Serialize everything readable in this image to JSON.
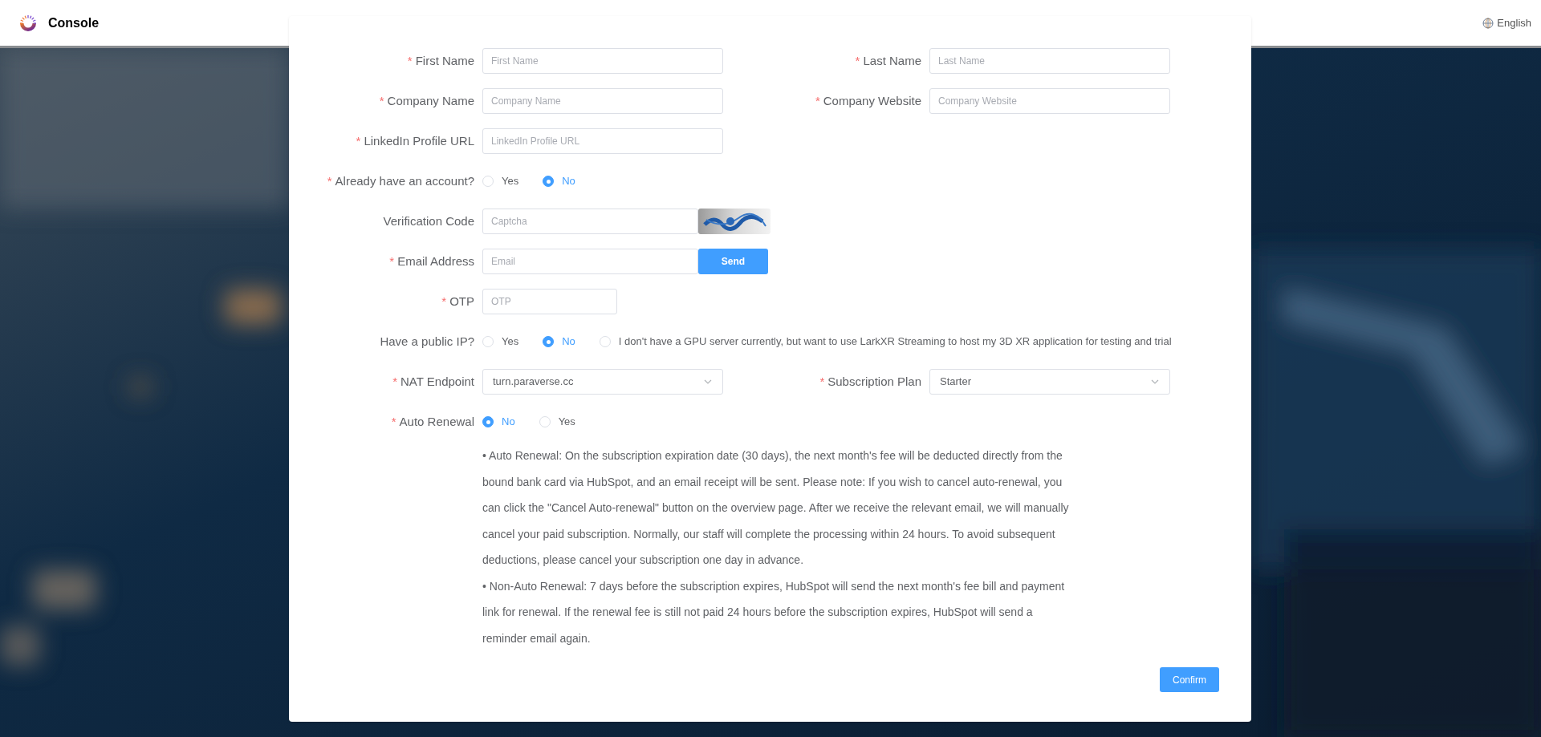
{
  "header": {
    "brand": "Console",
    "language": "English"
  },
  "form": {
    "rows": [
      {
        "fields": [
          {
            "kind": "text",
            "label": "First Name",
            "required_mark": "*",
            "placeholder": "First Name"
          },
          {
            "kind": "text",
            "label": "Last Name",
            "required_mark": "*",
            "placeholder": "Last Name"
          }
        ]
      },
      {
        "fields": [
          {
            "kind": "text",
            "label": "Company Name",
            "required_mark": "*",
            "placeholder": "Company Name"
          },
          {
            "kind": "text",
            "label": "Company Website",
            "required_mark": "*",
            "placeholder": "Company Website"
          }
        ]
      },
      {
        "fields": [
          {
            "kind": "text",
            "label": "LinkedIn Profile URL",
            "required_mark": "*",
            "placeholder": "LinkedIn Profile URL"
          }
        ]
      },
      {
        "fields": [
          {
            "kind": "radio",
            "label": "Already have an account?",
            "required_mark": "*",
            "options": [
              {
                "label": "Yes",
                "selected": false
              },
              {
                "label": "No",
                "selected": true
              }
            ]
          }
        ]
      },
      {
        "fields": [
          {
            "kind": "captcha",
            "label": "Verification Code",
            "placeholder": "Captcha"
          }
        ]
      },
      {
        "fields": [
          {
            "kind": "email",
            "label": "Email Address",
            "required_mark": "*",
            "placeholder": "Email",
            "button": "Send"
          }
        ]
      },
      {
        "fields": [
          {
            "kind": "short",
            "label": "OTP",
            "required_mark": "*",
            "placeholder": "OTP"
          }
        ]
      },
      {
        "fields": [
          {
            "kind": "radio",
            "label": "Have a public IP?",
            "options": [
              {
                "label": "Yes",
                "selected": false
              },
              {
                "label": "No",
                "selected": true
              },
              {
                "label": "I don't have a GPU server currently, but want to use LarkXR Streaming to host my 3D XR application for testing and trial",
                "selected": false
              }
            ]
          }
        ]
      },
      {
        "fields": [
          {
            "kind": "select",
            "label": "NAT Endpoint",
            "required_mark": "*",
            "value": "turn.paraverse.cc"
          },
          {
            "kind": "select",
            "label": "Subscription Plan",
            "required_mark": "*",
            "value": "Starter"
          }
        ]
      },
      {
        "fields": [
          {
            "kind": "radio",
            "label": "Auto Renewal",
            "required_mark": "*",
            "options": [
              {
                "label": "No",
                "selected": true
              },
              {
                "label": "Yes",
                "selected": false
              }
            ]
          }
        ]
      }
    ],
    "notes": [
      "• Auto Renewal: On the subscription expiration date (30 days), the next month's fee will be deducted directly from the bound bank card via HubSpot, and an email receipt will be sent. Please note: If you wish to cancel auto-renewal, you can click the \"Cancel Auto-renewal\" button on the overview page. After we receive the relevant email, we will manually cancel your paid subscription. Normally, our staff will complete the processing within 24 hours. To avoid subsequent deductions, please cancel your subscription one day in advance.",
      "• Non-Auto Renewal: 7 days before the subscription expires, HubSpot will send the next month's fee bill and payment link for renewal. If the renewal fee is still not paid 24 hours before the subscription expires, HubSpot will send a reminder email again."
    ],
    "confirm": "Confirm"
  }
}
